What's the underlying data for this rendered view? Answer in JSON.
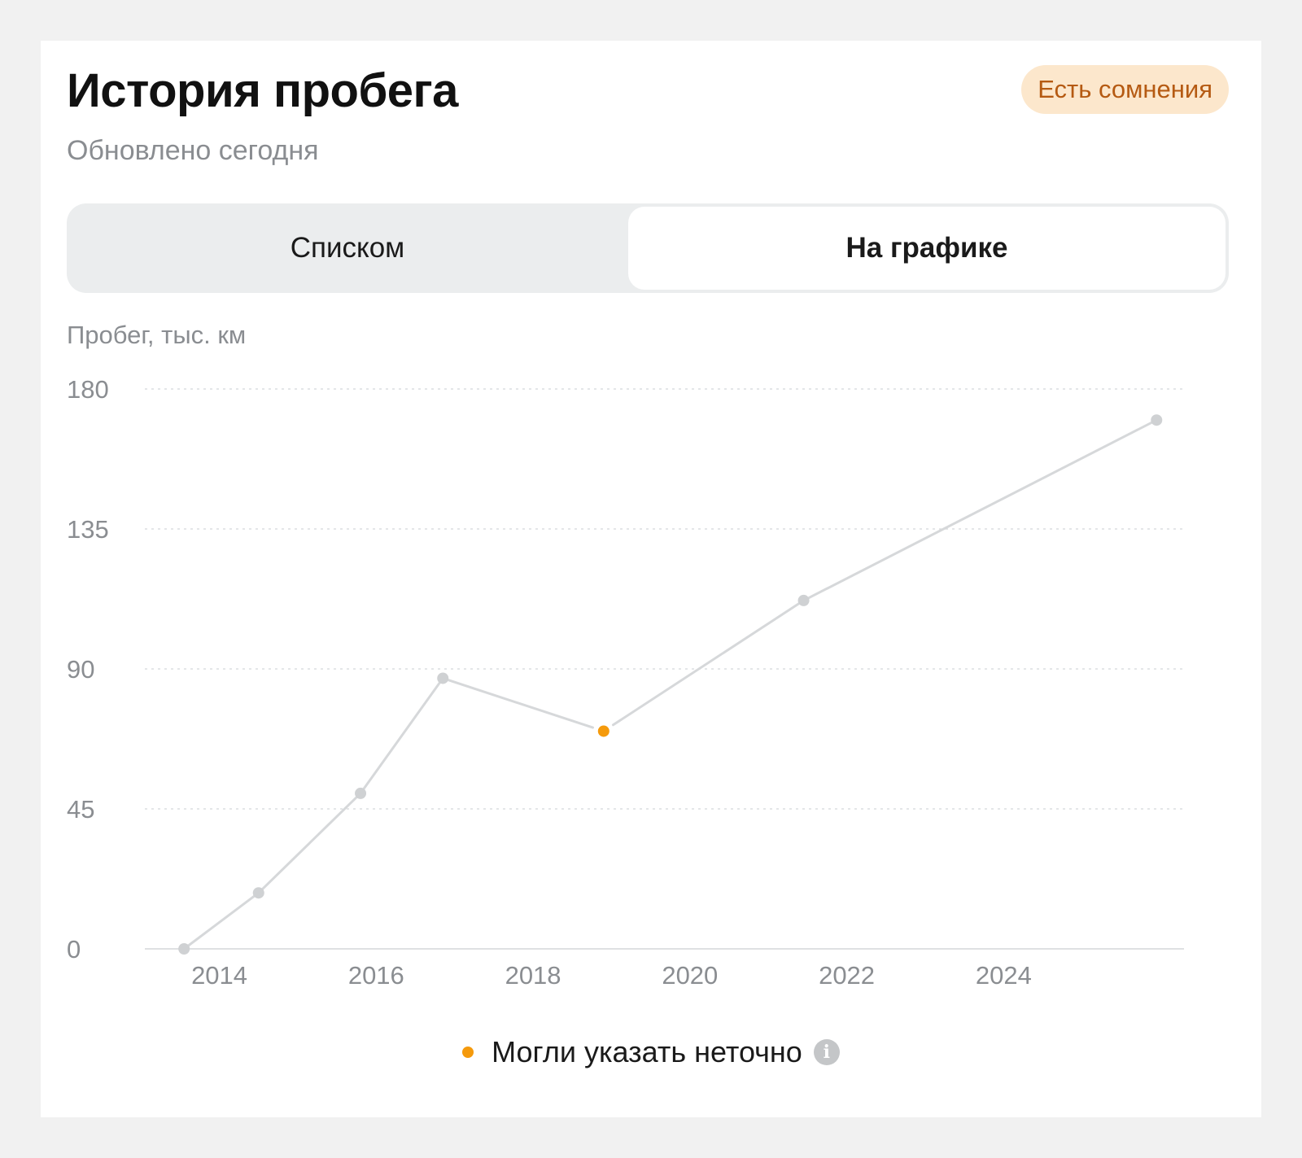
{
  "header": {
    "title": "История пробега",
    "subtitle": "Обновлено сегодня",
    "badge": "Есть сомнения"
  },
  "view_toggle": {
    "options": [
      "Списком",
      "На графике"
    ],
    "selected": "На графике"
  },
  "colors": {
    "line": "#d6d8da",
    "point": "#cfd1d3",
    "suspicious_point": "#f59a0c",
    "badge_bg": "#fce7cc",
    "badge_text": "#b55a12"
  },
  "legend": {
    "label": "Могли указать неточно",
    "info_icon": "info-icon"
  },
  "chart_data": {
    "type": "line",
    "ylabel": "Пробег, тыс. км",
    "xlabel": "",
    "ylim": [
      0,
      180
    ],
    "yticks": [
      0,
      45,
      90,
      135,
      180
    ],
    "xticks": [
      2014,
      2016,
      2018,
      2020,
      2022,
      2024
    ],
    "xlim": [
      2013.05,
      2026.3
    ],
    "grid": true,
    "series": [
      {
        "points": [
          {
            "x": 2013.55,
            "y": 0,
            "flag": false
          },
          {
            "x": 2014.5,
            "y": 18,
            "flag": false
          },
          {
            "x": 2015.8,
            "y": 50,
            "flag": false
          },
          {
            "x": 2016.85,
            "y": 87,
            "flag": false
          },
          {
            "x": 2018.9,
            "y": 70,
            "flag": true
          },
          {
            "x": 2021.45,
            "y": 112,
            "flag": false
          },
          {
            "x": 2025.95,
            "y": 170,
            "flag": false
          }
        ]
      }
    ]
  }
}
